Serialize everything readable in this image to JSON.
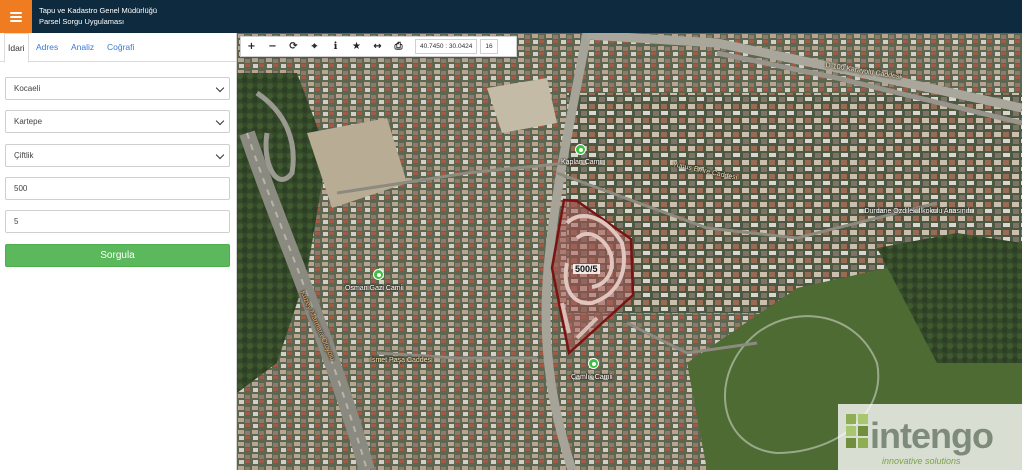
{
  "header": {
    "title_line1": "Tapu ve Kadastro Genel Müdürlüğü",
    "title_line2": "Parsel Sorgu Uygulaması",
    "menu_icon": "hamburger-icon"
  },
  "tabs": [
    "İdari",
    "Adres",
    "Analiz",
    "Coğrafi"
  ],
  "form": {
    "province": "Kocaeli",
    "district": "Kartepe",
    "neighborhood": "Çiftlik",
    "block": "500",
    "parcel": "5",
    "submit_label": "Sorgula"
  },
  "toolbar": {
    "icons": [
      "zoom-in-icon",
      "zoom-out-icon",
      "refresh-icon",
      "locate-icon",
      "info-icon",
      "star-icon",
      "measure-icon",
      "print-icon"
    ],
    "coordinates": "40.7450 : 30.0424",
    "zoom_level": "16"
  },
  "map": {
    "parcel_label": "500/5",
    "places": [
      "Kaplan Camii",
      "Osman Gazi Camii",
      "Çamlık Camii",
      "Durdane Özdilek İlkokulu Anasınıfı"
    ],
    "roads": [
      "D-100 Karayolu Caddesi",
      "Kuzey Marmara Otoyolu",
      "Yunus Emre Caddesi",
      "İsmet Paşa Caddesi"
    ]
  },
  "watermark": {
    "brand": "intengo",
    "tagline": "innovative solutions"
  },
  "colors": {
    "header_bg": "#0e2a3f",
    "menu_bg": "#f07c22",
    "button_green": "#5cb85c",
    "tab_link": "#3a7bd5",
    "parcel_outline": "#8b1a1a"
  }
}
